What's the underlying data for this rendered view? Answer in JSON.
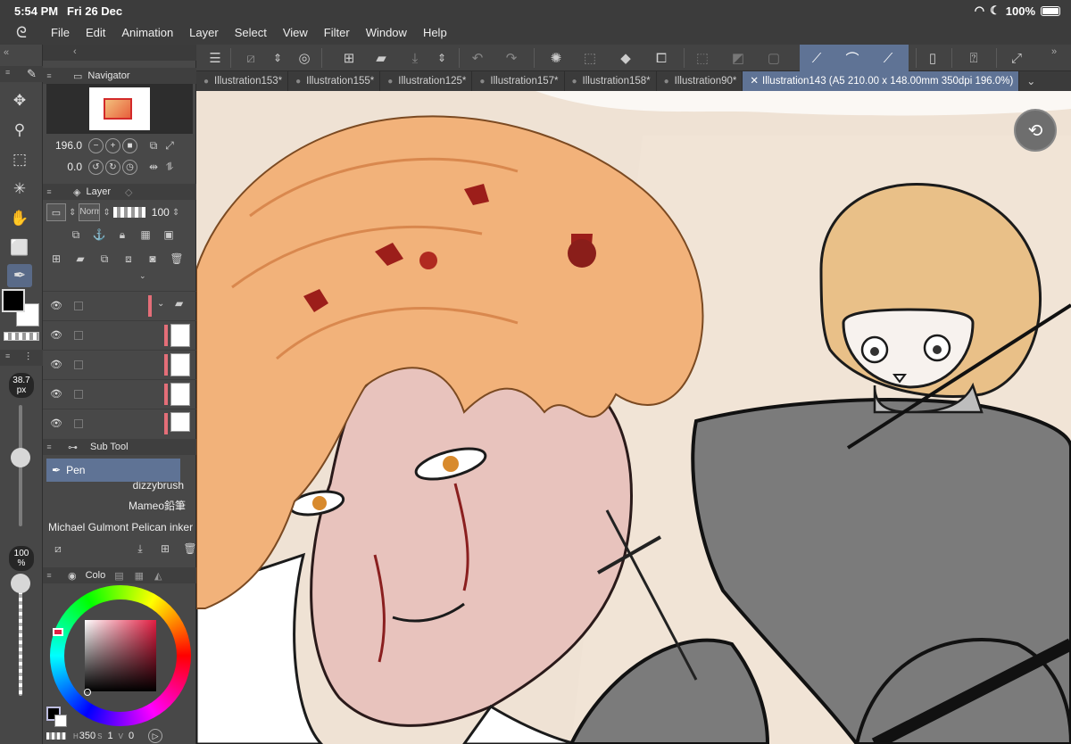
{
  "status": {
    "time": "5:54 PM",
    "date": "Fri 26 Dec",
    "battery": "100%"
  },
  "menu": [
    "File",
    "Edit",
    "Animation",
    "Layer",
    "Select",
    "View",
    "Filter",
    "Window",
    "Help"
  ],
  "navigator": {
    "title": "Navigator",
    "zoom": "196.0",
    "rotation": "0.0"
  },
  "layer": {
    "title": "Layer",
    "blend": "Norm",
    "opacity": "100"
  },
  "subtool": {
    "title": "Sub Tool",
    "selected": "Pen",
    "brushes": [
      "dizzybrush",
      "Mameo鉛筆",
      "Michael Gulmont Pelican inker"
    ]
  },
  "color": {
    "title": "Colo",
    "h": "350",
    "s": "1",
    "v": "0",
    "h_label": "H",
    "s_label": "S",
    "v_label": "V"
  },
  "brush_size": {
    "value": "38.7",
    "unit": "px"
  },
  "opacity_badge": {
    "value": "100",
    "unit": "%"
  },
  "tabs": [
    {
      "label": "Illustration153*",
      "active": false
    },
    {
      "label": "Illustration155*",
      "active": false
    },
    {
      "label": "Illustration125*",
      "active": false
    },
    {
      "label": "Illustration157*",
      "active": false
    },
    {
      "label": "Illustration158*",
      "active": false
    },
    {
      "label": "Illustration90*",
      "active": false
    },
    {
      "label": "Illustration143 (A5 210.00 x 148.00mm 350dpi 196.0%)",
      "active": true
    }
  ],
  "colors": {
    "main": "#000000",
    "sub": "#ffffff",
    "accent": "#5f7395",
    "hair": "#f2b27a",
    "chibi_hair": "#e9c088",
    "coat": "#7b7b7b",
    "paper": "#efe2d4"
  }
}
